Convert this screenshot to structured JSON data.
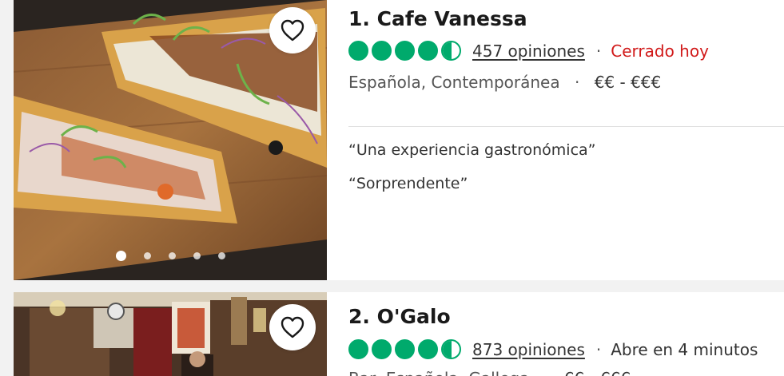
{
  "restaurants": [
    {
      "name": "1. Cafe Vanessa",
      "rating_bubbles": 4.5,
      "reviews": "457 opiniones",
      "status": "Cerrado hoy",
      "cuisine": "Española, Contemporánea",
      "price": "€€ - €€€",
      "quotes": [
        "“Una experiencia gastronómica”",
        "“Sorprendente”"
      ],
      "photo_count": 5,
      "active_photo": 1
    },
    {
      "name": "2. O'Galo",
      "rating_bubbles": 4.5,
      "reviews": "873 opiniones",
      "status": "Abre en 4 minutos",
      "cuisine": "Bar, Española, Gallega",
      "price": "€€ - €€€"
    }
  ],
  "separator": "·",
  "colors": {
    "rating_green": "#00aa6c",
    "closed_red": "#d11a1a"
  },
  "icons": {
    "favorite": "heart-outline-icon"
  }
}
